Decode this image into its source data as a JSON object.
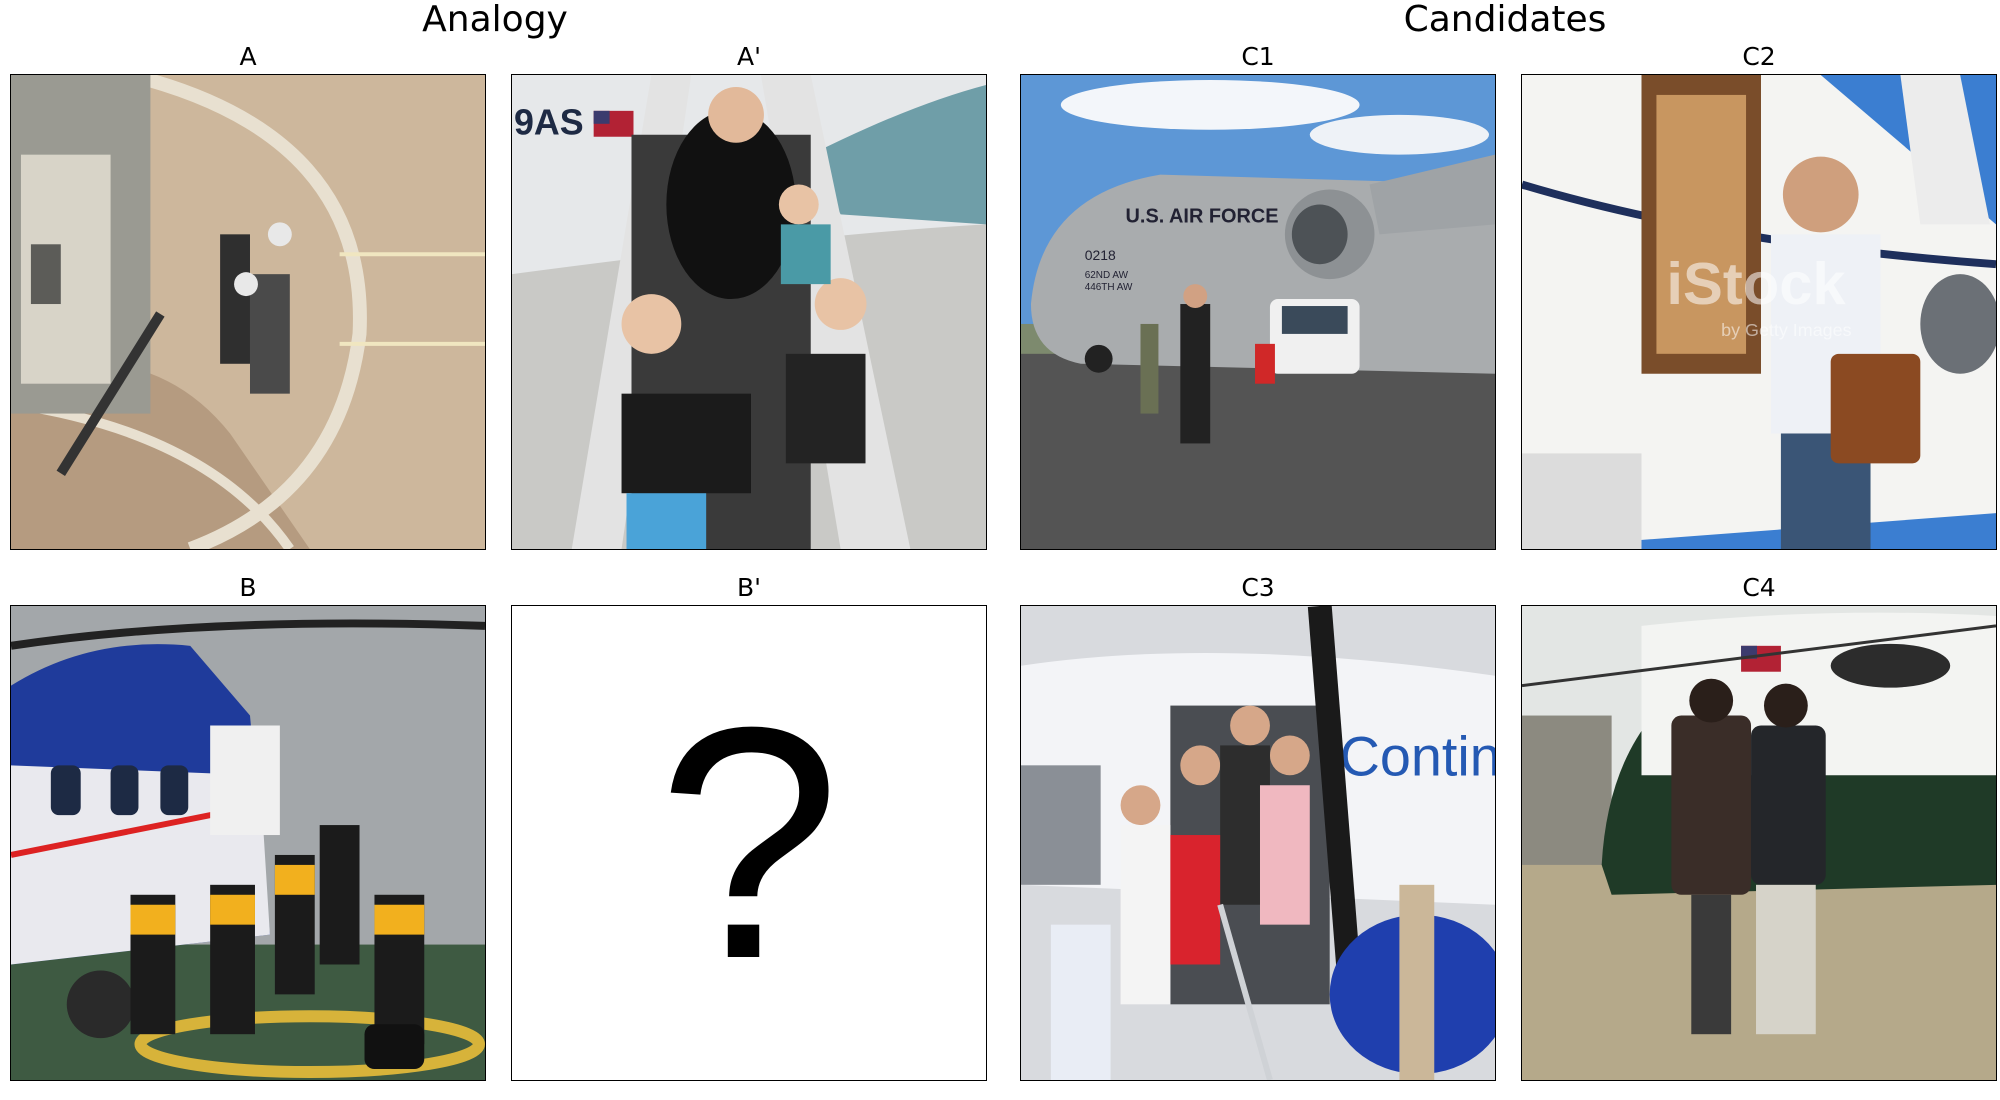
{
  "titles": {
    "analogy": "Analogy",
    "candidates": "Candidates"
  },
  "panels": {
    "a": "A",
    "a_prime": "A'",
    "b": "B",
    "b_prime": "B'",
    "c1": "C1",
    "c2": "C2",
    "c3": "C3",
    "c4": "C4"
  },
  "unknown_symbol": "?",
  "image_text": {
    "a_prime_tail": "9AS",
    "c1_fuselage": "U.S. AIR FORCE",
    "c1_tail_number": "0218",
    "c1_unit": "62ND AW",
    "c1_unit2": "446TH AW",
    "c2_watermark": "iStock",
    "c2_watermark_sub": "by Getty Images",
    "c3_livery": "Contin"
  }
}
